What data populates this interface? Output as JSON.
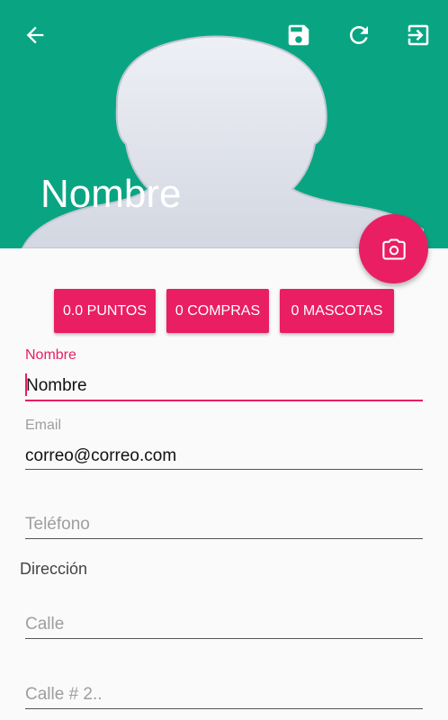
{
  "header": {
    "background_color": "#09a583",
    "title": "Nombre",
    "icons": {
      "back": "arrow-back-icon",
      "save": "save-icon",
      "refresh": "refresh-icon",
      "logout": "logout-icon"
    }
  },
  "fab": {
    "icon": "camera-icon",
    "color": "#e91e63"
  },
  "stats": {
    "points_label": "0.0 PUNTOS",
    "purchases_label": "0 COMPRAS",
    "pets_label": "0 MASCOTAS"
  },
  "form": {
    "name": {
      "label": "Nombre",
      "value": "Nombre"
    },
    "email": {
      "label": "Email",
      "value": "correo@correo.com"
    },
    "phone": {
      "placeholder": "Teléfono"
    },
    "address_section": "Dirección",
    "street": {
      "placeholder": "Calle"
    },
    "street2": {
      "placeholder": "Calle # 2.."
    }
  },
  "accent_color": "#e91e63"
}
